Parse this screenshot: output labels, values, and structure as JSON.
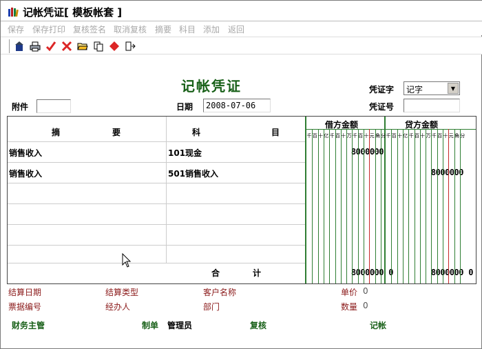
{
  "window": {
    "title": "记帐凭证[ 模板帐套 ]"
  },
  "menu": [
    "保存",
    "保存打印",
    "复核签名",
    "取消复核",
    "摘要",
    "科目",
    "添加",
    "返回"
  ],
  "toolbar_icons": [
    "exit-icon",
    "print-icon",
    "check-icon",
    "delete-icon",
    "open-folder-icon",
    "copy-icon",
    "diamond-icon",
    "insert-row-icon"
  ],
  "voucher": {
    "title": "记帐凭证",
    "attach_label": "附件",
    "attach_value": "",
    "date_label": "日期",
    "date_value": "2008-07-06",
    "word_label": "凭证字",
    "word_value": "记字",
    "number_label": "凭证号",
    "number_value": ""
  },
  "table": {
    "col_summary": [
      "摘",
      "要"
    ],
    "col_subject": [
      "科",
      "目"
    ],
    "debit_header": "借方金额",
    "credit_header": "贷方金额",
    "digit_units": [
      "千",
      "百",
      "十",
      "亿",
      "千",
      "百",
      "十",
      "万",
      "千",
      "百",
      "十",
      "元",
      "角",
      "分"
    ],
    "rows": [
      {
        "summary": "销售收入",
        "subject": "101现金",
        "debit": "8000000",
        "credit": ""
      },
      {
        "summary": "销售收入",
        "subject": "501销售收入",
        "debit": "",
        "credit": "8000000"
      },
      {
        "summary": "",
        "subject": "",
        "debit": "",
        "credit": ""
      },
      {
        "summary": "",
        "subject": "",
        "debit": "",
        "credit": ""
      },
      {
        "summary": "",
        "subject": "",
        "debit": "",
        "credit": ""
      },
      {
        "summary": "",
        "subject": "",
        "debit": "",
        "credit": ""
      }
    ],
    "total_label": [
      "合",
      "计"
    ],
    "total_debit": "8000000",
    "total_debit_zero": "0",
    "total_credit": "8000000",
    "total_credit_zero": "0"
  },
  "info": {
    "settle_date": "结算日期",
    "settle_type": "结算类型",
    "customer": "客户名称",
    "unit_price": "单价",
    "unit_price_value": "0",
    "bill_no": "票据编号",
    "handler": "经办人",
    "department": "部门",
    "quantity": "数量",
    "quantity_value": "0"
  },
  "footer": {
    "finance_head": "财务主管",
    "maker_label": "制单",
    "maker_value": "管理员",
    "review": "复核",
    "booked": "记帐"
  },
  "colors": {
    "green_title": "#186018",
    "info_text": "#8b1a1a",
    "debit_line": "#2e7d32",
    "yuan_line": "#c62828"
  }
}
